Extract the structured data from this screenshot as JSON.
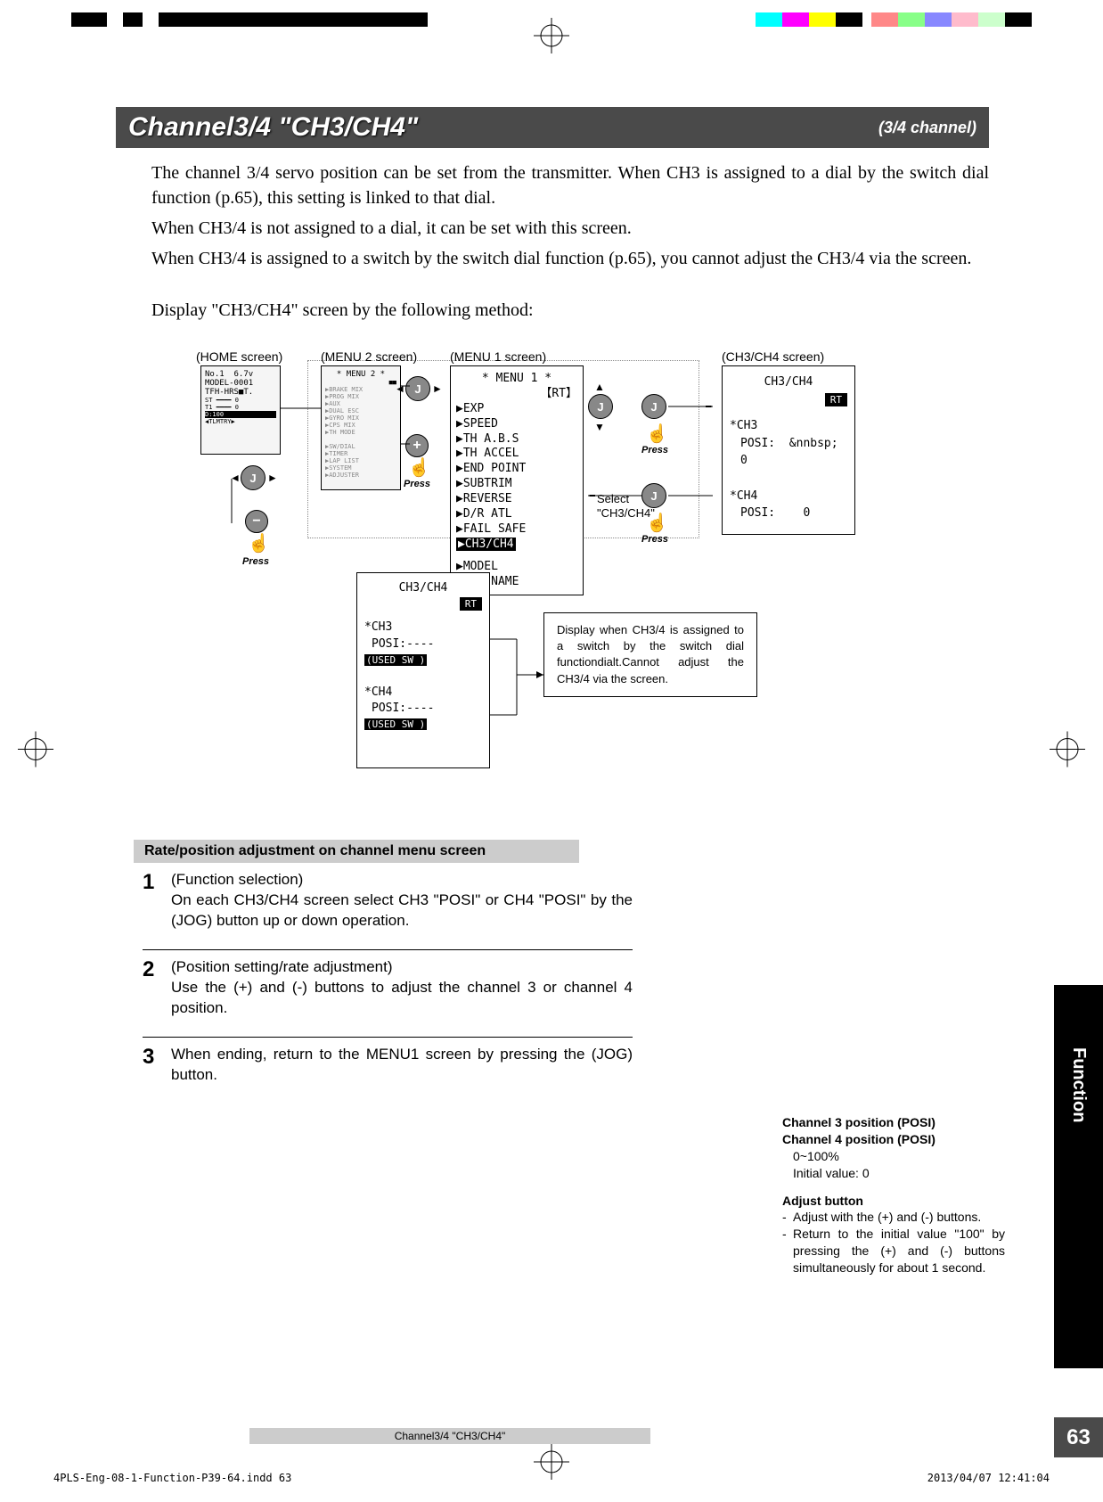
{
  "title": {
    "main": "Channel3/4  \"CH3/CH4\"",
    "sub": "(3/4 channel)"
  },
  "intro": {
    "p1": "The channel 3/4 servo position can be set from the transmitter. When CH3 is assigned to a dial by the switch dial function (p.65), this setting is linked to that dial.",
    "p2": "When CH3/4 is not assigned to a dial, it can be set with this screen.",
    "p3": "When CH3/4 is assigned to a switch by the switch dial function (p.65), you cannot adjust the CH3/4 via the screen.",
    "p4": "Display \"CH3/CH4\" screen by the following method:"
  },
  "diagram": {
    "labels": {
      "home": "(HOME screen)",
      "menu2": "(MENU 2 screen)",
      "menu1": "(MENU 1 screen)",
      "ch34": "(CH3/CH4 screen)"
    },
    "jog": "J",
    "plus": "+",
    "minus": "−",
    "press": "Press",
    "select_label": "Select \"CH3/CH4\"",
    "menu1": {
      "title": "* MENU 1 *",
      "rt": "【RT】",
      "items": [
        "▶EXP",
        "▶SPEED",
        "▶TH A.B.S",
        "▶TH ACCEL",
        "▶END POINT",
        "▶SUBTRIM",
        "▶REVERSE",
        "▶D/R ATL",
        "▶FAIL SAFE"
      ],
      "highlight": "▶CH3/CH4",
      "items2": [
        "▶MODEL",
        "▶MDL NAME"
      ]
    },
    "ch34screen": {
      "title": "CH3/CH4",
      "rt": "RT",
      "ch3_label": "*CH3",
      "ch3_posi": "POSI:",
      "ch3_val": "0",
      "ch4_label": "*CH4",
      "ch4_posi": "POSI:",
      "ch4_val": "0"
    },
    "example": {
      "title": "CH3/CH4",
      "rt": "RT",
      "ch3_label": "*CH3",
      "ch3_posi": "POSI:----",
      "ch3_used": "(USED SW )",
      "ch4_label": "*CH4",
      "ch4_posi": "POSI:----",
      "ch4_used": "(USED SW )"
    },
    "infobox": "Display when CH3/4 is assigned to a switch by the switch dial functiondialt.Cannot adjust the CH3/4 via the screen."
  },
  "section_header": "Rate/position adjustment on channel menu screen",
  "steps": {
    "s1": {
      "num": "1",
      "title": "(Function selection)",
      "body": "On each CH3/CH4 screen select CH3 \"POSI\" or CH4 \"POSI\" by the (JOG) button up or down operation."
    },
    "s2": {
      "num": "2",
      "title": "(Position setting/rate adjustment)",
      "body": "Use the (+) and (-) buttons to adjust the channel 3 or channel 4 position."
    },
    "s3": {
      "num": "3",
      "body": "When ending, return to the MENU1 screen by pressing the (JOG) button."
    }
  },
  "side": {
    "h1": "Channel 3 position (POSI)",
    "h2": "Channel 4 position (POSI)",
    "range": "0~100%",
    "init": "Initial value: 0",
    "adj_h": "Adjust button",
    "adj_b1": "Adjust with the (+) and (-) buttons.",
    "adj_b2": "Return to the initial value \"100\" by pressing the (+) and (-) buttons simultaneously for about 1 second."
  },
  "side_tab": "Function",
  "page_num": "63",
  "footer": "Channel3/4  \"CH3/CH4\"",
  "print": {
    "left": "4PLS-Eng-08-1-Function-P39-64.indd   63",
    "right": "2013/04/07   12:41:04"
  }
}
